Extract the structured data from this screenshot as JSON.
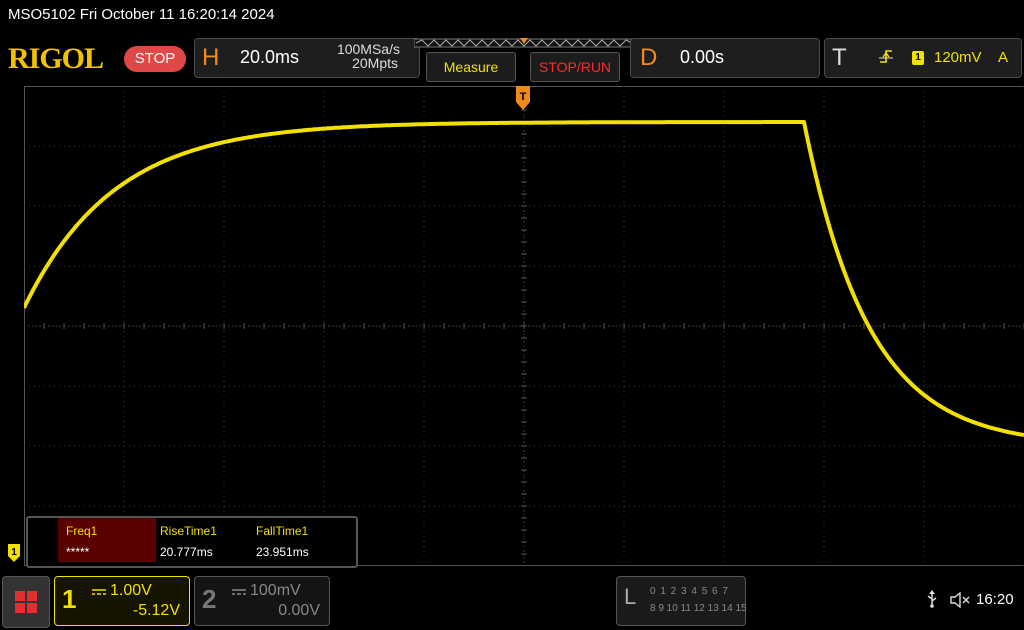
{
  "titlebar": {
    "text": "MSO5102  Fri October 11 16:20:14 2024"
  },
  "brand": {
    "logo": "RIGOL",
    "status": "STOP"
  },
  "horizontal": {
    "letter": "H",
    "timebase": "20.0ms",
    "sample_rate": "100MSa/s",
    "memory_depth": "20Mpts"
  },
  "toolbar": {
    "measure_label": "Measure",
    "stoprun_label": "STOP/RUN"
  },
  "delay": {
    "letter": "D",
    "value": "0.00s"
  },
  "trigger": {
    "letter": "T",
    "source": "1",
    "level": "120mV",
    "mode": "A",
    "marker": "T"
  },
  "channels": [
    {
      "number": "1",
      "scale": "1.00V",
      "offset": "-5.12V",
      "color": "#f2e000",
      "marker": "1"
    },
    {
      "number": "2",
      "scale": "100mV",
      "offset": "0.00V",
      "color": "#888888"
    }
  ],
  "measurements": [
    {
      "label": "Freq1",
      "value": "*****"
    },
    {
      "label": "RiseTime1",
      "value": "20.777ms"
    },
    {
      "label": "FallTime1",
      "value": "23.951ms"
    }
  ],
  "logic": {
    "letter": "L",
    "row1": "0 1 2 3  4 5 6 7",
    "row2": "8 9 10 11 12 13 14 15"
  },
  "status_bar": {
    "clock": "16:20"
  },
  "icons": {
    "menu": "grid-menu-icon",
    "usb": "usb-icon",
    "speaker": "speaker-muted-icon"
  },
  "waveform": {
    "color": "#f2e000",
    "timebase_ms_per_div": 20,
    "volts_per_div": 1.0,
    "low_level_div": -2.0,
    "high_level_div": 3.4,
    "rise_start_div": -5.5,
    "fall_start_div": 2.8,
    "rise_tau_div": 0.9,
    "fall_tau_div": 0.65
  }
}
